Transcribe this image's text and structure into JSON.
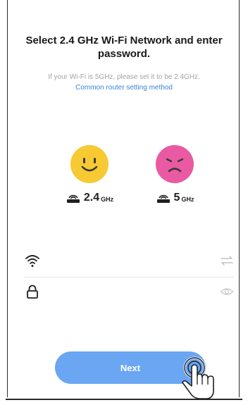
{
  "page": {
    "title": "Select 2.4 GHz Wi-Fi Network and enter password.",
    "subtitle": "If your Wi-Fi is 5GHz, please set it to be 2.4GHz.",
    "router_link": "Common router setting method"
  },
  "bands": [
    {
      "number": "2.4",
      "unit": "GHz",
      "status": "supported",
      "face_icon": "smiley-face-icon",
      "face_color": "#f7c933"
    },
    {
      "number": "5",
      "unit": "GHz",
      "status": "unsupported",
      "face_icon": "sad-face-icon",
      "face_color": "#ea5aa2"
    }
  ],
  "form": {
    "ssid": {
      "value": "",
      "placeholder": "",
      "leading_icon": "wifi-icon",
      "trailing_icon": "switch-network-icon"
    },
    "password": {
      "value": "",
      "placeholder": "",
      "leading_icon": "lock-icon",
      "trailing_icon": "eye-icon"
    }
  },
  "actions": {
    "next_label": "Next"
  },
  "colors": {
    "accent": "#6aa6f2",
    "link": "#3b84d9",
    "muted": "#a4a4a4"
  }
}
